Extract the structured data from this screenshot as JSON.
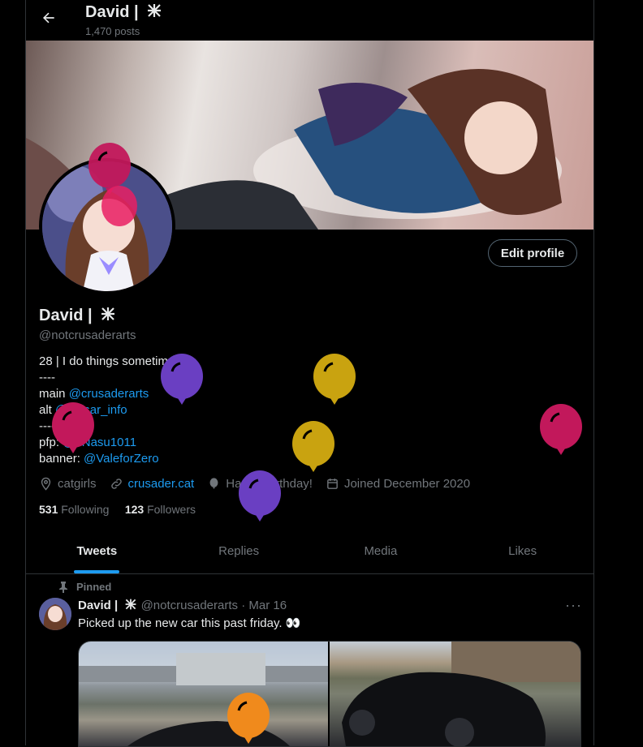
{
  "header": {
    "back_icon": "arrow-left-icon",
    "name": "David |",
    "posts": "1,470 posts"
  },
  "profile": {
    "edit_label": "Edit profile",
    "name": "David |",
    "handle": "@notcrusaderarts",
    "bio": {
      "line1": "28 | I do things sometimes.",
      "sep1": "----",
      "main_prefix": "main ",
      "main_link": "@crusaderarts",
      "alt_prefix": "alt ",
      "alt_link": "@phlsar_info",
      "sep2": "----",
      "pfp_prefix": "pfp: ",
      "pfp_link": "@0Nasu1011",
      "banner_prefix": "banner: ",
      "banner_link": "@ValeforZero"
    },
    "meta": {
      "location": "catgirls",
      "website": "crusader.cat",
      "birthday": "Happy Birthday!",
      "joined": "Joined December 2020"
    },
    "following_count": "531",
    "following_label": "Following",
    "followers_count": "123",
    "followers_label": "Followers"
  },
  "tabs": [
    {
      "label": "Tweets",
      "active": true
    },
    {
      "label": "Replies",
      "active": false
    },
    {
      "label": "Media",
      "active": false
    },
    {
      "label": "Likes",
      "active": false
    }
  ],
  "tweet": {
    "pinned_label": "Pinned",
    "name": "David |",
    "handle": "@notcrusaderarts",
    "dot": "·",
    "date": "Mar 16",
    "more": "···",
    "text": "Picked up the new car this past friday. 👀"
  },
  "colors": {
    "accent": "#1d9bf0",
    "balloon_pink": "#c2185b",
    "balloon_purple": "#6a3fc2",
    "balloon_gold": "#c9a310",
    "balloon_orange": "#f08a1c"
  }
}
